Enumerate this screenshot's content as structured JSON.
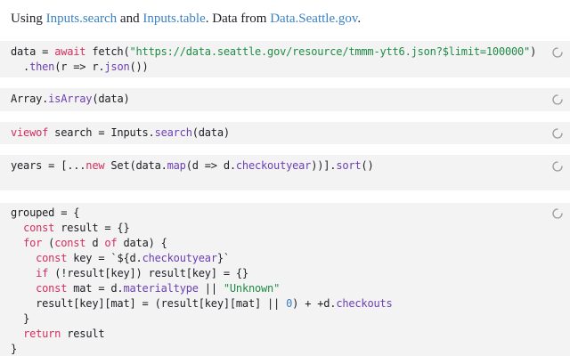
{
  "intro": {
    "prefix": "Using ",
    "link1": "Inputs.search",
    "and": " and ",
    "link2": "Inputs.table",
    "mid": ". Data from ",
    "link3": "Data.Seattle.gov",
    "suffix": "."
  },
  "cells": {
    "c1": {
      "l1_a": "data",
      "l1_b": " = ",
      "l1_c": "await",
      "l1_d": " fetch(",
      "l1_e": "\"https://data.seattle.gov/resource/tmmm-ytt6.json?$limit=100000\"",
      "l1_f": ")",
      "l2_a": "  .",
      "l2_b": "then",
      "l2_c": "(r => r.",
      "l2_d": "json",
      "l2_e": "())"
    },
    "c2": {
      "a": "Array.",
      "b": "isArray",
      "c": "(data)"
    },
    "c3": {
      "a": "viewof",
      "b": " search = Inputs.",
      "c": "search",
      "d": "(data)"
    },
    "c4": {
      "a": "years = [...",
      "b": "new",
      "c": " Set(data.",
      "d": "map",
      "e": "(d => d.",
      "f": "checkoutyear",
      "g": "))].",
      "h": "sort",
      "i": "()"
    },
    "c5": {
      "l1": "grouped = {",
      "l2_k": "const",
      "l2_r": " result = {}",
      "l3_k1": "for",
      "l3_a": " (",
      "l3_k2": "const",
      "l3_b": " d ",
      "l3_k3": "of",
      "l3_c": " data) {",
      "l4_k": "const",
      "l4_a": " key = ",
      "l4_s": "`${",
      "l4_b": "d.",
      "l4_p": "checkoutyear",
      "l4_s2": "}`",
      "l5_k": "if",
      "l5_a": " (!result[key]) result[key] = {}",
      "l6_k": "const",
      "l6_a": " mat = d.",
      "l6_p": "materialtype",
      "l6_b": " || ",
      "l6_s": "\"Unknown\"",
      "l7_a": "result[key][mat] = (result[key][mat] || ",
      "l7_n": "0",
      "l7_b": ") + +d.",
      "l7_p": "checkouts",
      "l8": "}",
      "l9_k": "return",
      "l9_a": " result",
      "l10": "}"
    }
  },
  "colors": {
    "keyword": "#d42e5f",
    "string": "#1f8c46",
    "property": "#6c3fb1",
    "number": "#3b82c4",
    "link": "#3b82c4",
    "cell_bg": "#f3f3f3"
  },
  "icons": [
    "loading-spinner-icon"
  ]
}
